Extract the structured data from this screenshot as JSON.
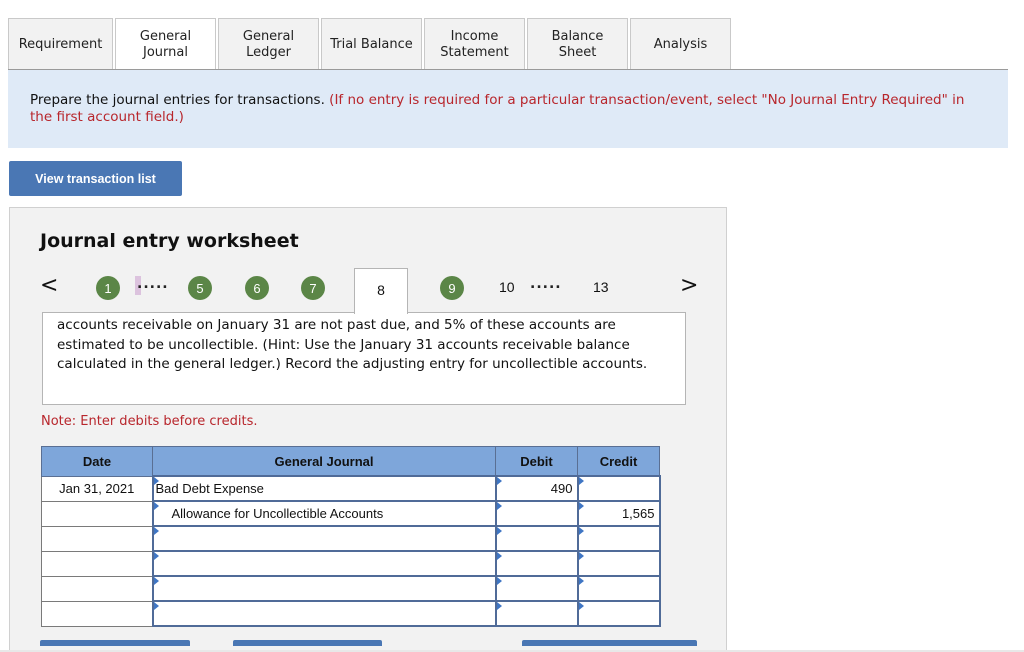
{
  "tabs": [
    {
      "label": "Requirement",
      "active": false
    },
    {
      "label": "General Journal",
      "active": true
    },
    {
      "label": "General Ledger",
      "active": false
    },
    {
      "label": "Trial Balance",
      "active": false
    },
    {
      "label": "Income Statement",
      "active": false
    },
    {
      "label": "Balance Sheet",
      "active": false
    },
    {
      "label": "Analysis",
      "active": false
    }
  ],
  "instructions": {
    "main": "Prepare the journal entries for transactions. ",
    "note": "(If no entry is required for a particular transaction/event, select \"No Journal Entry Required\" in the first account field.)"
  },
  "view_transaction_button": "View transaction list",
  "worksheet": {
    "title": "Journal entry worksheet",
    "pager": {
      "prev_icon": "‹",
      "next_icon": "›",
      "items": [
        "1",
        "5",
        "6",
        "7",
        "8",
        "9",
        "10",
        "13"
      ],
      "completed": [
        "1",
        "5",
        "6",
        "7",
        "9"
      ],
      "current": "8",
      "ellipsis": "....."
    },
    "description": "accounts receivable on January 31 are not past due, and 5% of these accounts are estimated to be uncollectible. (Hint: Use the January 31 accounts receivable balance calculated in the general ledger.) Record the adjusting entry for uncollectible accounts.",
    "note": "Note: Enter debits before credits.",
    "table": {
      "headers": [
        "Date",
        "General Journal",
        "Debit",
        "Credit"
      ],
      "rows": [
        {
          "date": "Jan 31, 2021",
          "account": "Bad Debt Expense",
          "debit": "490",
          "credit": ""
        },
        {
          "date": "",
          "account": "Allowance for Uncollectible Accounts",
          "debit": "",
          "credit": "1,565"
        },
        {
          "date": "",
          "account": "",
          "debit": "",
          "credit": ""
        },
        {
          "date": "",
          "account": "",
          "debit": "",
          "credit": ""
        },
        {
          "date": "",
          "account": "",
          "debit": "",
          "credit": ""
        },
        {
          "date": "",
          "account": "",
          "debit": "",
          "credit": ""
        }
      ]
    }
  }
}
